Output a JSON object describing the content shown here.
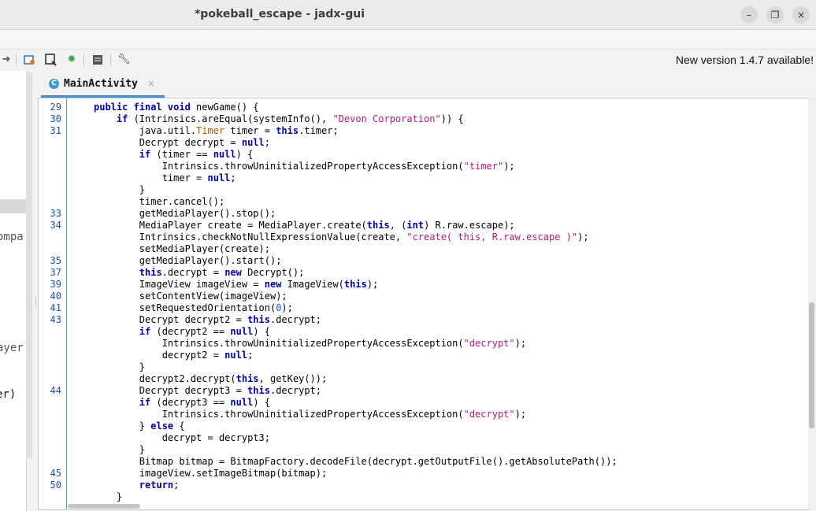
{
  "window": {
    "title": "*pokeball_escape - jadx-gui",
    "minimize": "–",
    "restore": "❐",
    "close": "×"
  },
  "toolbar": {
    "update_notice": "New version 1.4.7 available!"
  },
  "left_panel": {
    "fragments": [
      "ompa",
      "ayer",
      "er)"
    ]
  },
  "tab": {
    "label": "MainActivity",
    "icon_letter": "C",
    "close": "×"
  },
  "code_lines": [
    {
      "n": "29",
      "html": "<span class='kw'>public final void</span> newGame() {"
    },
    {
      "n": "30",
      "html": "    <span class='kw'>if</span> (Intrinsics.areEqual(systemInfo(), <span class='str'>\"Devon Corporation\"</span>)) {"
    },
    {
      "n": "31",
      "html": "        java.util.<span class='typ'>Timer</span> timer = <span class='kw'>this</span>.timer;"
    },
    {
      "n": "",
      "html": "        Decrypt decrypt = <span class='kw'>null</span>;"
    },
    {
      "n": "",
      "html": "        <span class='kw'>if</span> (timer == <span class='kw'>null</span>) {"
    },
    {
      "n": "",
      "html": "            Intrinsics.throwUninitializedPropertyAccessException(<span class='str'>\"timer\"</span>);"
    },
    {
      "n": "",
      "html": "            timer = <span class='kw'>null</span>;"
    },
    {
      "n": "",
      "html": "        }"
    },
    {
      "n": "",
      "html": "        timer.cancel();"
    },
    {
      "n": "33",
      "html": "        getMediaPlayer().stop();"
    },
    {
      "n": "34",
      "html": "        MediaPlayer create = MediaPlayer.create(<span class='kw'>this</span>, (<span class='kw'>int</span>) R.raw.escape);"
    },
    {
      "n": "",
      "html": "        Intrinsics.checkNotNullExpressionValue(create, <span class='str'>\"create( this, R.raw.escape )\"</span>);"
    },
    {
      "n": "",
      "html": "        setMediaPlayer(create);"
    },
    {
      "n": "35",
      "html": "        getMediaPlayer().start();"
    },
    {
      "n": "37",
      "html": "        <span class='kw'>this</span>.decrypt = <span class='kw'>new</span> Decrypt();"
    },
    {
      "n": "39",
      "html": "        ImageView imageView = <span class='kw'>new</span> ImageView(<span class='kw'>this</span>);"
    },
    {
      "n": "40",
      "html": "        setContentView(imageView);"
    },
    {
      "n": "41",
      "html": "        setRequestedOrientation(<span class='num'>0</span>);"
    },
    {
      "n": "43",
      "html": "        Decrypt decrypt2 = <span class='kw'>this</span>.decrypt;"
    },
    {
      "n": "",
      "html": "        <span class='kw'>if</span> (decrypt2 == <span class='kw'>null</span>) {"
    },
    {
      "n": "",
      "html": "            Intrinsics.throwUninitializedPropertyAccessException(<span class='str'>\"decrypt\"</span>);"
    },
    {
      "n": "",
      "html": "            decrypt2 = <span class='kw'>null</span>;"
    },
    {
      "n": "",
      "html": "        }"
    },
    {
      "n": "",
      "html": "        decrypt2.decrypt(<span class='kw'>this</span>, getKey());"
    },
    {
      "n": "44",
      "html": "        Decrypt decrypt3 = <span class='kw'>this</span>.decrypt;"
    },
    {
      "n": "",
      "html": "        <span class='kw'>if</span> (decrypt3 == <span class='kw'>null</span>) {"
    },
    {
      "n": "",
      "html": "            Intrinsics.throwUninitializedPropertyAccessException(<span class='str'>\"decrypt\"</span>);"
    },
    {
      "n": "",
      "html": "        } <span class='kw'>else</span> {"
    },
    {
      "n": "",
      "html": "            decrypt = decrypt3;"
    },
    {
      "n": "",
      "html": "        }"
    },
    {
      "n": "",
      "html": "        Bitmap bitmap = BitmapFactory.decodeFile(decrypt.getOutputFile().getAbsolutePath());"
    },
    {
      "n": "45",
      "html": "        imageView.setImageBitmap(bitmap);"
    },
    {
      "n": "50",
      "html": "        <span class='kw'>return</span>;"
    },
    {
      "n": "",
      "html": "    }"
    }
  ]
}
